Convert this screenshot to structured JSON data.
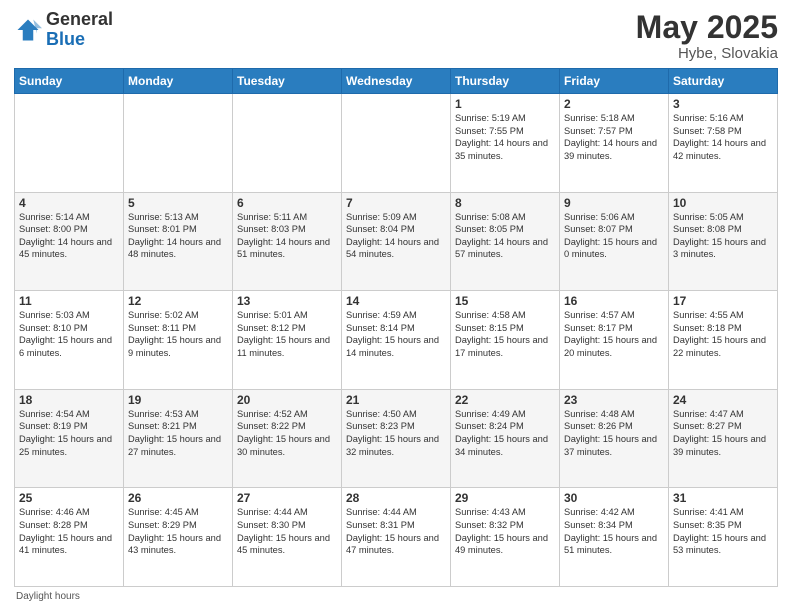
{
  "logo": {
    "general": "General",
    "blue": "Blue"
  },
  "title": {
    "month": "May 2025",
    "location": "Hybe, Slovakia"
  },
  "weekdays": [
    "Sunday",
    "Monday",
    "Tuesday",
    "Wednesday",
    "Thursday",
    "Friday",
    "Saturday"
  ],
  "weeks": [
    [
      {
        "day": "",
        "info": ""
      },
      {
        "day": "",
        "info": ""
      },
      {
        "day": "",
        "info": ""
      },
      {
        "day": "",
        "info": ""
      },
      {
        "day": "1",
        "info": "Sunrise: 5:19 AM\nSunset: 7:55 PM\nDaylight: 14 hours and 35 minutes."
      },
      {
        "day": "2",
        "info": "Sunrise: 5:18 AM\nSunset: 7:57 PM\nDaylight: 14 hours and 39 minutes."
      },
      {
        "day": "3",
        "info": "Sunrise: 5:16 AM\nSunset: 7:58 PM\nDaylight: 14 hours and 42 minutes."
      }
    ],
    [
      {
        "day": "4",
        "info": "Sunrise: 5:14 AM\nSunset: 8:00 PM\nDaylight: 14 hours and 45 minutes."
      },
      {
        "day": "5",
        "info": "Sunrise: 5:13 AM\nSunset: 8:01 PM\nDaylight: 14 hours and 48 minutes."
      },
      {
        "day": "6",
        "info": "Sunrise: 5:11 AM\nSunset: 8:03 PM\nDaylight: 14 hours and 51 minutes."
      },
      {
        "day": "7",
        "info": "Sunrise: 5:09 AM\nSunset: 8:04 PM\nDaylight: 14 hours and 54 minutes."
      },
      {
        "day": "8",
        "info": "Sunrise: 5:08 AM\nSunset: 8:05 PM\nDaylight: 14 hours and 57 minutes."
      },
      {
        "day": "9",
        "info": "Sunrise: 5:06 AM\nSunset: 8:07 PM\nDaylight: 15 hours and 0 minutes."
      },
      {
        "day": "10",
        "info": "Sunrise: 5:05 AM\nSunset: 8:08 PM\nDaylight: 15 hours and 3 minutes."
      }
    ],
    [
      {
        "day": "11",
        "info": "Sunrise: 5:03 AM\nSunset: 8:10 PM\nDaylight: 15 hours and 6 minutes."
      },
      {
        "day": "12",
        "info": "Sunrise: 5:02 AM\nSunset: 8:11 PM\nDaylight: 15 hours and 9 minutes."
      },
      {
        "day": "13",
        "info": "Sunrise: 5:01 AM\nSunset: 8:12 PM\nDaylight: 15 hours and 11 minutes."
      },
      {
        "day": "14",
        "info": "Sunrise: 4:59 AM\nSunset: 8:14 PM\nDaylight: 15 hours and 14 minutes."
      },
      {
        "day": "15",
        "info": "Sunrise: 4:58 AM\nSunset: 8:15 PM\nDaylight: 15 hours and 17 minutes."
      },
      {
        "day": "16",
        "info": "Sunrise: 4:57 AM\nSunset: 8:17 PM\nDaylight: 15 hours and 20 minutes."
      },
      {
        "day": "17",
        "info": "Sunrise: 4:55 AM\nSunset: 8:18 PM\nDaylight: 15 hours and 22 minutes."
      }
    ],
    [
      {
        "day": "18",
        "info": "Sunrise: 4:54 AM\nSunset: 8:19 PM\nDaylight: 15 hours and 25 minutes."
      },
      {
        "day": "19",
        "info": "Sunrise: 4:53 AM\nSunset: 8:21 PM\nDaylight: 15 hours and 27 minutes."
      },
      {
        "day": "20",
        "info": "Sunrise: 4:52 AM\nSunset: 8:22 PM\nDaylight: 15 hours and 30 minutes."
      },
      {
        "day": "21",
        "info": "Sunrise: 4:50 AM\nSunset: 8:23 PM\nDaylight: 15 hours and 32 minutes."
      },
      {
        "day": "22",
        "info": "Sunrise: 4:49 AM\nSunset: 8:24 PM\nDaylight: 15 hours and 34 minutes."
      },
      {
        "day": "23",
        "info": "Sunrise: 4:48 AM\nSunset: 8:26 PM\nDaylight: 15 hours and 37 minutes."
      },
      {
        "day": "24",
        "info": "Sunrise: 4:47 AM\nSunset: 8:27 PM\nDaylight: 15 hours and 39 minutes."
      }
    ],
    [
      {
        "day": "25",
        "info": "Sunrise: 4:46 AM\nSunset: 8:28 PM\nDaylight: 15 hours and 41 minutes."
      },
      {
        "day": "26",
        "info": "Sunrise: 4:45 AM\nSunset: 8:29 PM\nDaylight: 15 hours and 43 minutes."
      },
      {
        "day": "27",
        "info": "Sunrise: 4:44 AM\nSunset: 8:30 PM\nDaylight: 15 hours and 45 minutes."
      },
      {
        "day": "28",
        "info": "Sunrise: 4:44 AM\nSunset: 8:31 PM\nDaylight: 15 hours and 47 minutes."
      },
      {
        "day": "29",
        "info": "Sunrise: 4:43 AM\nSunset: 8:32 PM\nDaylight: 15 hours and 49 minutes."
      },
      {
        "day": "30",
        "info": "Sunrise: 4:42 AM\nSunset: 8:34 PM\nDaylight: 15 hours and 51 minutes."
      },
      {
        "day": "31",
        "info": "Sunrise: 4:41 AM\nSunset: 8:35 PM\nDaylight: 15 hours and 53 minutes."
      }
    ]
  ],
  "footer": "Daylight hours"
}
